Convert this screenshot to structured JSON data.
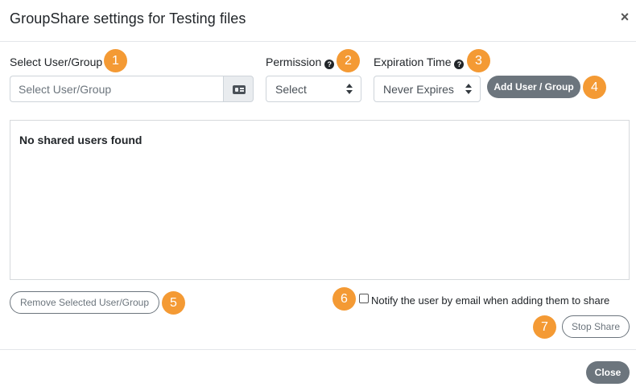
{
  "modal": {
    "title": "GroupShare settings for Testing files",
    "close_glyph": "×"
  },
  "form": {
    "user_group": {
      "label": "Select User/Group",
      "placeholder": "Select User/Group",
      "addon_icon": "contact-card-icon"
    },
    "permission": {
      "label": "Permission",
      "help_glyph": "?",
      "selected": "Select"
    },
    "expiration": {
      "label": "Expiration Time",
      "help_glyph": "?",
      "selected": "Never Expires"
    },
    "add_button": "Add User / Group"
  },
  "shared_list": {
    "empty_message": "No shared users found"
  },
  "actions": {
    "remove_button": "Remove Selected User/Group",
    "notify_label": "Notify the user by email when adding them to share",
    "notify_checked": false,
    "stop_share_button": "Stop Share"
  },
  "footer": {
    "close_button": "Close"
  },
  "badges": [
    "1",
    "2",
    "3",
    "4",
    "5",
    "6",
    "7"
  ],
  "colors": {
    "badge": "#f49a34",
    "button_dark": "#6c757d",
    "border": "#ced4da"
  }
}
